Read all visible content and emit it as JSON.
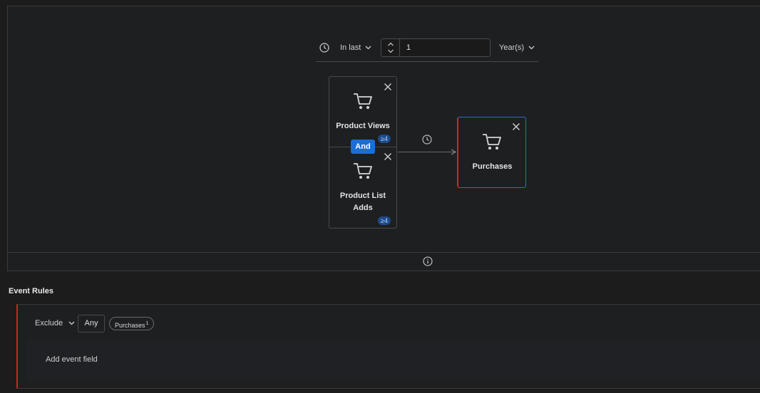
{
  "time_constraint": {
    "mode_label": "In last",
    "value": "1",
    "unit_label": "Year(s)"
  },
  "sequence": {
    "group": {
      "operator_label": "And",
      "events": [
        {
          "label": "Product Views",
          "count_badge": "≥4",
          "icon": "shopping-cart-icon"
        },
        {
          "label": "Product List Adds",
          "count_badge": "≥4",
          "icon": "shopping-cart-icon"
        }
      ]
    },
    "then_event": {
      "label": "Purchases",
      "icon": "shopping-cart-icon"
    }
  },
  "event_rules": {
    "title": "Event Rules",
    "exclude_label": "Exclude",
    "any_label": "Any",
    "chip_label": "Purchases",
    "chip_superscript": "1",
    "add_field_label": "Add event field"
  },
  "colors": {
    "accent_blue": "#1a6fd4",
    "badge_blue": "#1d4a8a",
    "exclude_red": "#c62828",
    "background": "#1c1c1c"
  }
}
